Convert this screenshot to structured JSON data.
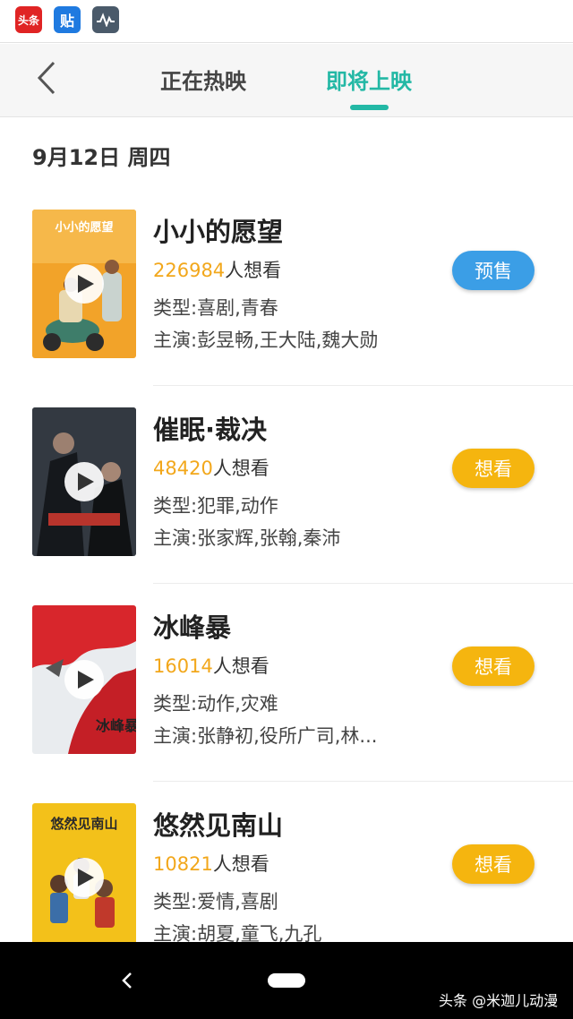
{
  "status_bar": {
    "icons": [
      {
        "name": "toutiao-app-icon",
        "label": "头条"
      },
      {
        "name": "tieba-app-icon",
        "label": "贴"
      },
      {
        "name": "activity-monitor-icon",
        "label": ""
      }
    ]
  },
  "header": {
    "back_icon": "chevron-left-icon",
    "tabs": [
      {
        "label": "正在热映",
        "active": false
      },
      {
        "label": "即将上映",
        "active": true
      }
    ],
    "accent_color": "#23b8a5"
  },
  "date_heading": "9月12日 周四",
  "movies": [
    {
      "title": "小小的愿望",
      "want_count": "226984",
      "want_suffix": "人想看",
      "genre": "类型:喜剧,青春",
      "cast": "主演:彭昱畅,王大陆,魏大勋",
      "action": "预售",
      "action_color": "#3b9ee6"
    },
    {
      "title": "催眠·裁决",
      "want_count": "48420",
      "want_suffix": "人想看",
      "genre": "类型:犯罪,动作",
      "cast": "主演:张家辉,张翰,秦沛",
      "action": "想看",
      "action_color": "#f5b50f"
    },
    {
      "title": "冰峰暴",
      "want_count": "16014",
      "want_suffix": "人想看",
      "genre": "类型:动作,灾难",
      "cast": "主演:张静初,役所广司,林...",
      "action": "想看",
      "action_color": "#f5b50f"
    },
    {
      "title": "悠然见南山",
      "want_count": "10821",
      "want_suffix": "人想看",
      "genre": "类型:爱情,喜剧",
      "cast": "主演:胡夏,童飞,九孔",
      "action": "想看",
      "action_color": "#f5b50f"
    }
  ],
  "nav_bar": {
    "back_icon": "nav-back-icon",
    "home_icon": "nav-home-icon"
  },
  "watermark": "头条 @米迦儿动漫"
}
